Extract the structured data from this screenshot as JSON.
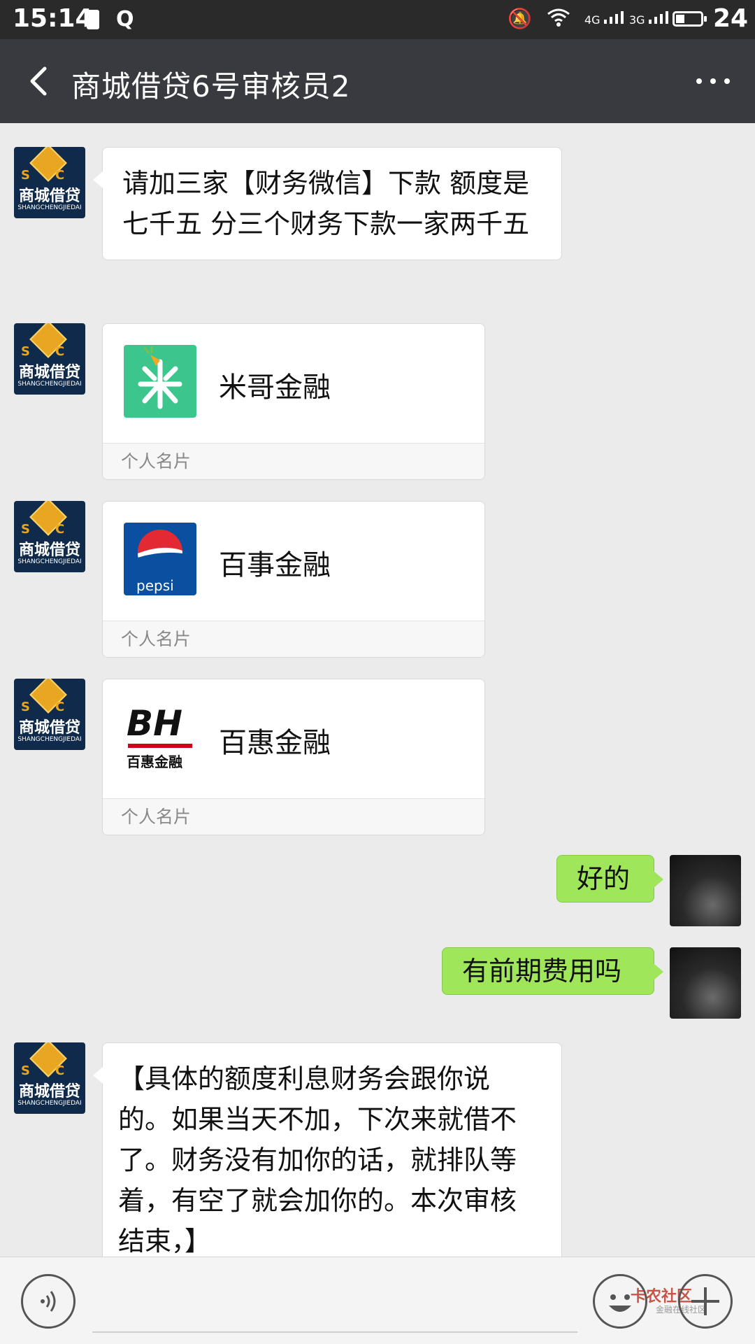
{
  "status_bar": {
    "time": "15:14",
    "signal_4g": "4G",
    "signal_3g": "3G",
    "battery_level": "24"
  },
  "header": {
    "title": "商城借贷6号审核员2"
  },
  "avatar_contact": {
    "cn": "商城借贷",
    "en": "SHANGCHENGJIEDAI",
    "sc": "SC"
  },
  "messages": {
    "m1": "请加三家【财务微信】下款 额度是七千五 分三个财务下款一家两千五",
    "card1": {
      "name": "米哥金融",
      "footer": "个人名片"
    },
    "card2": {
      "name": "百事金融",
      "footer": "个人名片",
      "logo_text": "pepsi"
    },
    "card3": {
      "name": "百惠金融",
      "footer": "个人名片",
      "logo_top": "BH",
      "logo_bottom": "百惠金融"
    },
    "r1": "好的",
    "r2": "有前期费用吗",
    "m2": "【具体的额度利息财务会跟你说的。如果当天不加，下次来就借不了。财务没有加你的话，就排队等着，有空了就会加你的。本次审核结束，】"
  },
  "watermark": {
    "text": "卡农社区",
    "sub": "金融在线社区"
  },
  "colors": {
    "header_bg": "#393a3f",
    "chat_bg": "#ebebeb",
    "bubble_right": "#9fe65a",
    "mige_green": "#3cc58c",
    "pepsi_blue": "#0a4fa0"
  }
}
